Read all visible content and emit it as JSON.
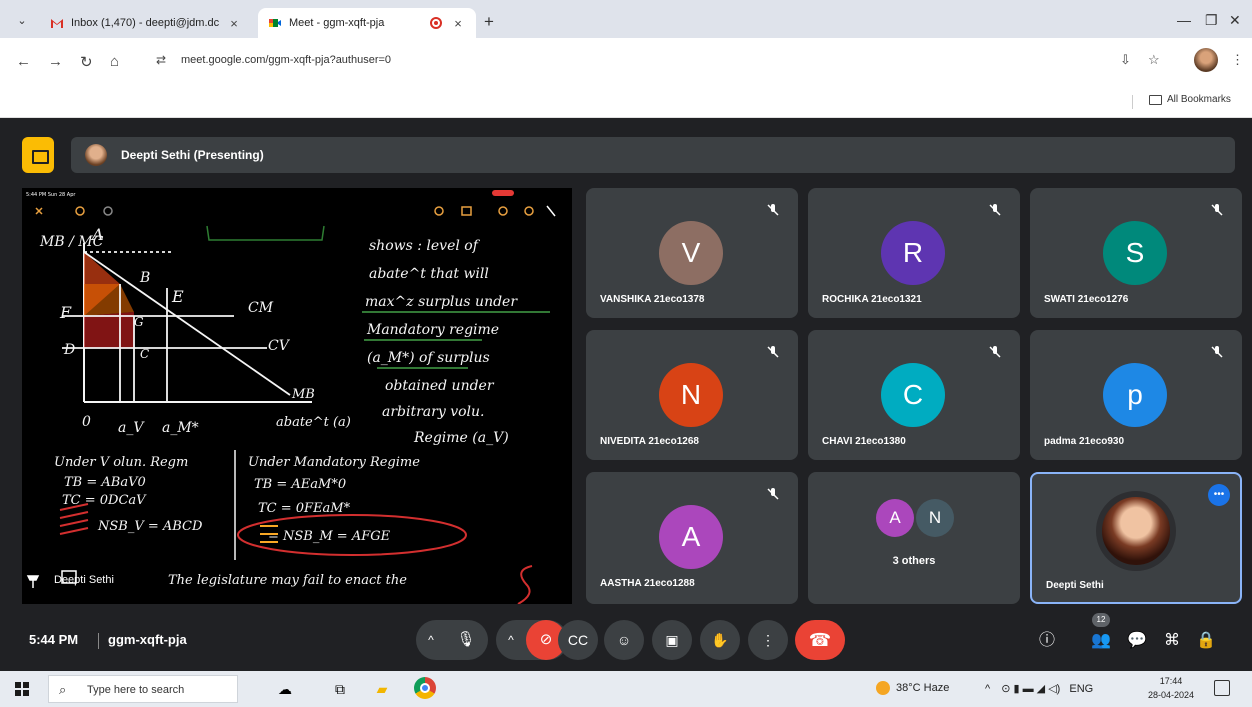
{
  "browser": {
    "tabs": [
      {
        "title": "Inbox (1,470) - deepti@jdm.dc",
        "active": false
      },
      {
        "title": "Meet - ggm-xqft-pja",
        "active": true
      }
    ],
    "url": "meet.google.com/ggm-xqft-pja?authuser=0",
    "bookmarks_label": "All Bookmarks"
  },
  "meet": {
    "presenter": "Deepti Sethi (Presenting)",
    "screen_caption": "Deepti Sethi",
    "participants": [
      {
        "initial": "V",
        "name": "VANSHIKA 21eco1378",
        "color": "#8d6e63"
      },
      {
        "initial": "R",
        "name": "ROCHIKA 21eco1321",
        "color": "#5e35b1"
      },
      {
        "initial": "S",
        "name": "SWATI 21eco1276",
        "color": "#00897b"
      },
      {
        "initial": "N",
        "name": "NIVEDITA 21eco1268",
        "color": "#d84315"
      },
      {
        "initial": "C",
        "name": "CHAVI 21eco1380",
        "color": "#00acc1"
      },
      {
        "initial": "p",
        "name": "padma 21eco930",
        "color": "#1e88e5"
      },
      {
        "initial": "A",
        "name": "AASTHA 21eco1288",
        "color": "#ab47bc"
      }
    ],
    "others": {
      "initials": [
        "A",
        "N"
      ],
      "label": "3 others"
    },
    "self_name": "Deepti Sethi",
    "time": "5:44 PM",
    "meeting_code": "ggm-xqft-pja",
    "participant_count": "12"
  },
  "whiteboard": {
    "status_time": "5:44 PM  Sun 28 Apr",
    "labels": {
      "mb_mc": "MB / MC",
      "a": "A",
      "b": "B",
      "e": "E",
      "f": "F",
      "g": "G",
      "d": "D",
      "c": "C",
      "zero": "0",
      "cm": "CM",
      "cv": "CV",
      "mb": "MB",
      "av": "a_V",
      "am": "a_M*",
      "abate": "abate^t (a)",
      "note": [
        "shows : level of",
        "abate^t that will",
        "max^z surplus under",
        "Mandatory regime",
        "(a_M*) of surplus",
        "obtained under",
        "arbitrary volu.",
        "Regime (a_V)"
      ],
      "left_block": [
        "Under V olun. Regm",
        "TB = ABaV0",
        "TC = 0DCaV",
        "NSB_V = ABCD"
      ],
      "right_block": [
        "Under Mandatory Regime",
        "TB = AEaM*0",
        "TC = 0FEaM*",
        "= NSB_M = AFGE"
      ],
      "footer": "The legislature may fail to enact the"
    }
  },
  "taskbar": {
    "search_placeholder": "Type here to search",
    "weather": "38°C  Haze",
    "lang": "ENG",
    "time": "17:44",
    "date": "28-04-2024"
  }
}
